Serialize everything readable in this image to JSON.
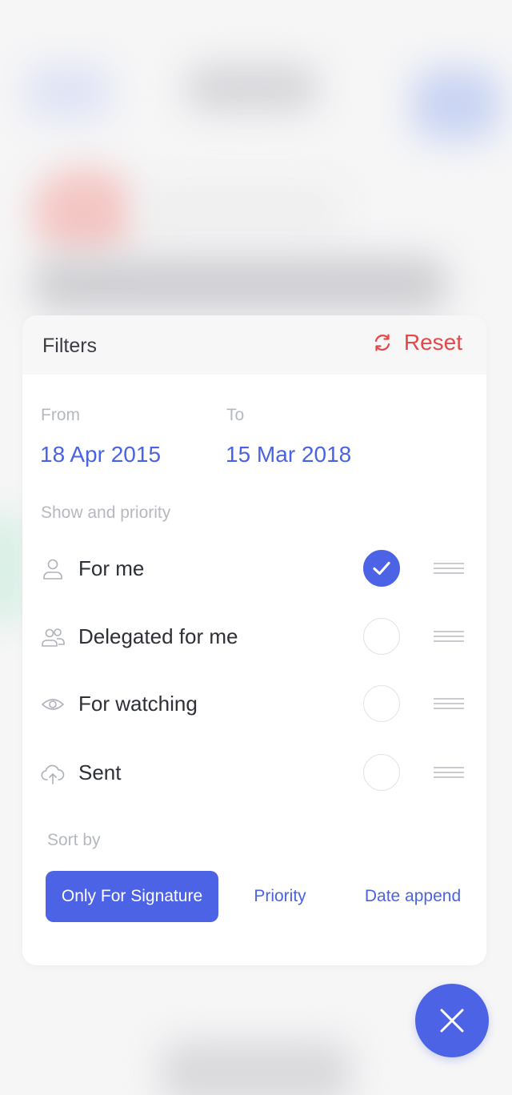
{
  "header": {
    "title": "Filters",
    "reset_label": "Reset"
  },
  "dates": {
    "from_label": "From",
    "from_value": "18 Apr 2015",
    "to_label": "To",
    "to_value": "15 Mar 2018"
  },
  "show_priority": {
    "label": "Show and priority",
    "items": [
      {
        "label": "For me",
        "icon": "user-icon",
        "checked": true
      },
      {
        "label": "Delegated for me",
        "icon": "users-icon",
        "checked": false
      },
      {
        "label": "For watching",
        "icon": "eye-icon",
        "checked": false
      },
      {
        "label": "Sent",
        "icon": "cloud-upload-icon",
        "checked": false
      }
    ]
  },
  "sort": {
    "label": "Sort by",
    "options": [
      "Only For Signature",
      "Priority",
      "Date append"
    ],
    "selected": "Only For Signature"
  },
  "colors": {
    "accent": "#4d63e5",
    "reset": "#e54848"
  }
}
